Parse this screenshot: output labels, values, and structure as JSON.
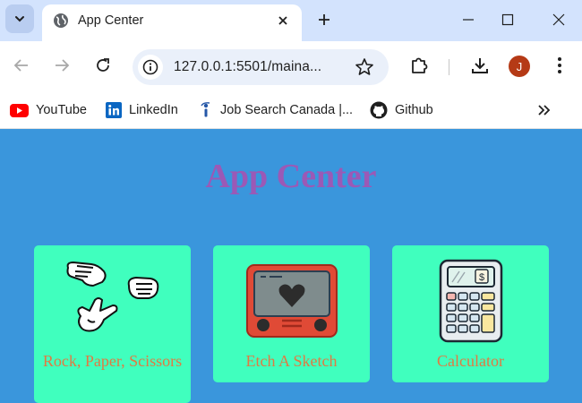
{
  "browser": {
    "tab_title": "App Center",
    "url": "127.0.0.1:5501/maina...",
    "avatar_letter": "J",
    "bookmarks": [
      {
        "label": "YouTube",
        "icon": "youtube-icon"
      },
      {
        "label": "LinkedIn",
        "icon": "linkedin-icon"
      },
      {
        "label": "Job Search Canada |...",
        "icon": "job-search-icon"
      },
      {
        "label": "Github",
        "icon": "github-icon"
      }
    ]
  },
  "page": {
    "title": "App Center",
    "title_color": "#9b59b6",
    "background_color": "#3a96dc",
    "card_color": "#40ffbe",
    "label_color": "#e07a43",
    "apps": [
      {
        "label": "Rock, Paper, Scissors",
        "icon": "rock-paper-scissors-hands-icon"
      },
      {
        "label": "Etch A Sketch",
        "icon": "etch-a-sketch-icon"
      },
      {
        "label": "Calculator",
        "icon": "calculator-icon"
      }
    ]
  }
}
